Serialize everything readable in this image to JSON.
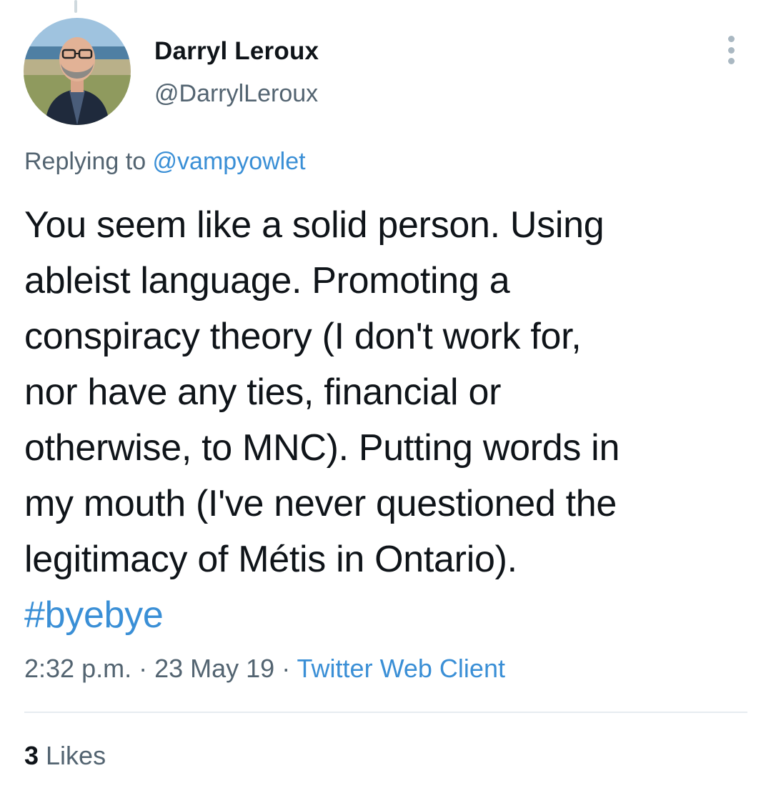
{
  "author": {
    "name": "Darryl Leroux",
    "handle": "@DarrylLeroux"
  },
  "more_icon": "more-vertical-icon",
  "reply_context": {
    "prefix": "Replying to ",
    "mention": "@vampyowlet"
  },
  "tweet": {
    "lines": [
      "You seem like a solid person. Using",
      "ableist language. Promoting a",
      "conspiracy theory (I don't work for,",
      "nor have any ties, financial or",
      "otherwise, to MNC). Putting words in",
      "my mouth (I've never questioned the",
      "legitimacy of Métis in Ontario)."
    ],
    "hashtag": "#byebye"
  },
  "meta": {
    "time": "2:32 p.m.",
    "sep1": " · ",
    "date": "23 May 19",
    "sep2": " · ",
    "client": "Twitter Web Client"
  },
  "stats": {
    "likes_count": "3",
    "likes_label": " Likes"
  },
  "colors": {
    "link": "#3a8fd6",
    "secondary_text": "#536471",
    "primary_text": "#0f1419",
    "divider": "#e6ecf0"
  }
}
